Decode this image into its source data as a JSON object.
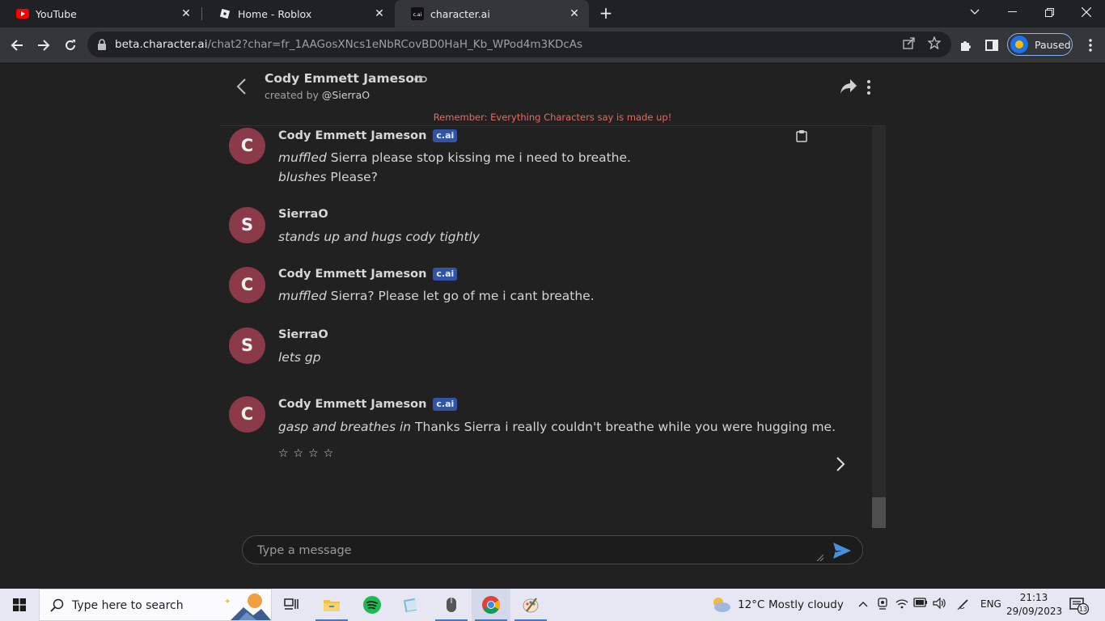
{
  "browser": {
    "tabs": [
      {
        "title": "YouTube",
        "active": false,
        "icon": "youtube-icon"
      },
      {
        "title": "Home - Roblox",
        "active": false,
        "icon": "roblox-icon"
      },
      {
        "title": "character.ai",
        "active": true,
        "icon": "cai-icon",
        "favicon_text": "c.ai"
      }
    ],
    "url_host": "beta.character.ai",
    "url_path": "/chat2?char=fr_1AAGosXNcs1eNbRCovBD0HaH_Kb_WPod4m3KDcAs",
    "profile_status": "Paused"
  },
  "chat": {
    "character_name": "Cody Emmett Jameson",
    "created_by_prefix": "created by",
    "creator": "@SierraO",
    "warning": "Remember: Everything Characters say is made up!",
    "badge": "c.ai",
    "messages": [
      {
        "sender": "Cody Emmett Jameson",
        "initial": "C",
        "is_bot": true,
        "lines": [
          {
            "action": "muffled",
            "text": " Sierra please stop kissing me i need to breathe."
          },
          {
            "action": "blushes",
            "text": " Please?"
          }
        ]
      },
      {
        "sender": "SierraO",
        "initial": "S",
        "is_bot": false,
        "lines": [
          {
            "action": "stands up and hugs cody tightly",
            "text": ""
          }
        ]
      },
      {
        "sender": "Cody Emmett Jameson",
        "initial": "C",
        "is_bot": true,
        "lines": [
          {
            "action": "muffled",
            "text": " Sierra? Please let go of me i cant breathe."
          }
        ]
      },
      {
        "sender": "SierraO",
        "initial": "S",
        "is_bot": false,
        "lines": [
          {
            "action": "lets gp",
            "text": ""
          }
        ]
      },
      {
        "sender": "Cody Emmett Jameson",
        "initial": "C",
        "is_bot": true,
        "lines": [
          {
            "action": "gasp and breathes in",
            "text": " Thanks Sierra i really couldn't breathe while you were hugging me."
          }
        ]
      }
    ],
    "rating_stars": "☆☆☆☆",
    "input_placeholder": "Type a message"
  },
  "taskbar": {
    "search_placeholder": "Type here to search",
    "weather_temp": "12°C",
    "weather_desc": "Mostly cloudy",
    "language": "ENG",
    "time": "21:13",
    "date": "29/09/2023",
    "notification_count": "13"
  }
}
